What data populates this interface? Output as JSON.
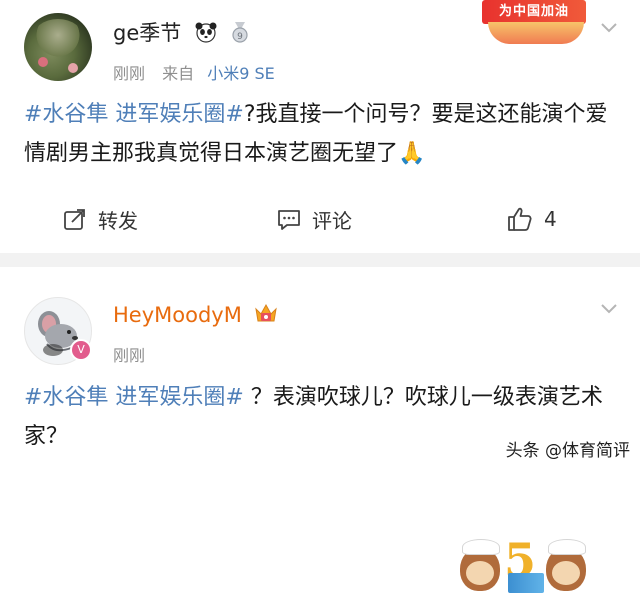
{
  "post1": {
    "username": "ge季节",
    "time": "刚刚",
    "source_prefix": "来自",
    "device": "小米9 SE",
    "hashtag": "#水谷隼 进军娱乐圈#",
    "text": "?我直接一个问号？要是这还能演个爱情剧男主那我真觉得日本演艺圈无望了🙏",
    "badge_text": "为中国加油",
    "actions": {
      "repost_label": "转发",
      "comment_label": "评论",
      "like_count": "4"
    }
  },
  "post2": {
    "username": "HeyMoodyM",
    "time": "刚刚",
    "hashtag": "#水谷隼 进军娱乐圈#",
    "text": " ？表演吹球儿？吹球儿一级表演艺术家？",
    "vip_badge": "V",
    "fan_badge_number": "5"
  },
  "watermark": "头条 @体育简评",
  "colors": {
    "link": "#4f7fb8",
    "vip_name": "#e86b0e",
    "meta": "#8f8f8f"
  }
}
